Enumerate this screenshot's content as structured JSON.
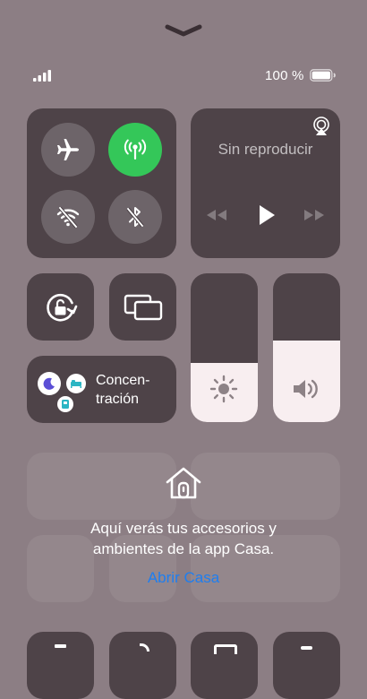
{
  "status_bar": {
    "battery_text": "100 %",
    "battery_level": 1.0
  },
  "connectivity": {
    "airplane": {
      "icon": "airplane-icon",
      "on": false
    },
    "cellular": {
      "icon": "antenna-icon",
      "on": true,
      "color": "#34c759"
    },
    "wifi": {
      "icon": "wifi-off-icon",
      "on": false
    },
    "bluetooth": {
      "icon": "bluetooth-off-icon",
      "on": false
    }
  },
  "media": {
    "title": "Sin reproducir"
  },
  "focus": {
    "label": "Concen-\nttración"
  },
  "sliders": {
    "brightness_level": 0.4,
    "volume_level": 0.55
  },
  "home": {
    "message": "Aquí verás tus accesorios y ambientes de la app Casa.",
    "link": "Abrir Casa",
    "link_color": "#1e7ef0"
  }
}
